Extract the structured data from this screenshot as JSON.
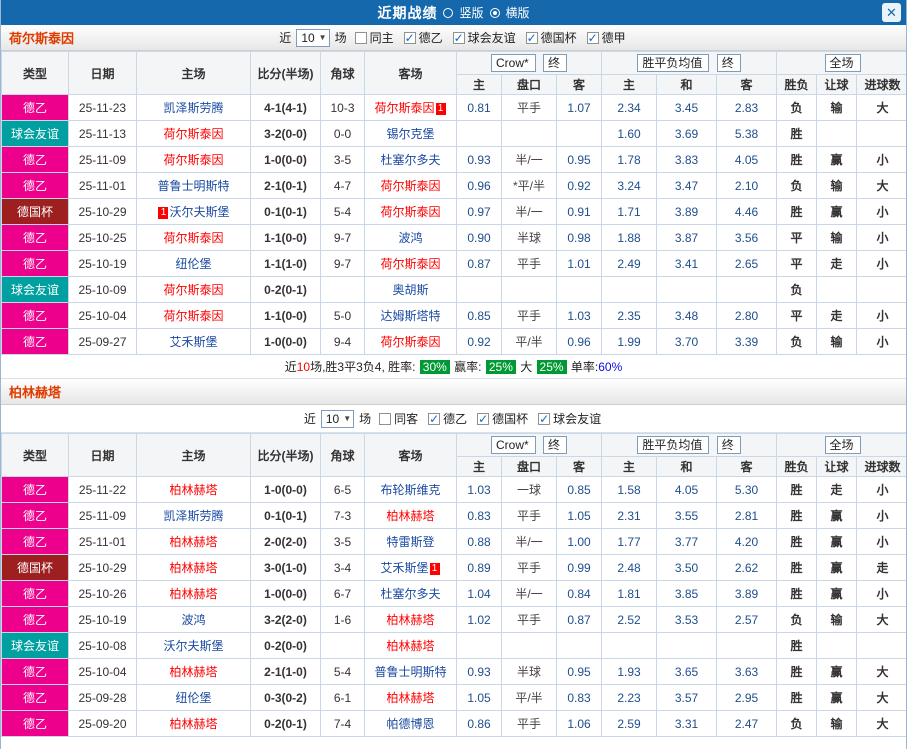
{
  "titlebar": {
    "title": "近期战绩",
    "options": [
      {
        "label": "竖版",
        "checked": false
      },
      {
        "label": "横版",
        "checked": true
      }
    ]
  },
  "icons": {
    "chevron_down": "▼",
    "close": "✕"
  },
  "col_headers": {
    "type": "类型",
    "date": "日期",
    "home": "主场",
    "score": "比分(半场)",
    "corner": "角球",
    "away": "客场",
    "ah_home": "主",
    "ah_line": "盘口",
    "ah_away": "客",
    "eu_home": "主",
    "eu_draw": "和",
    "eu_away": "客",
    "wdl": "胜负",
    "handicap": "让球",
    "goals": "进球数"
  },
  "sections": [
    {
      "team": "荷尔斯泰因",
      "filter_inline": true,
      "filter": {
        "prefix": "近",
        "count": "10",
        "suffix": "场",
        "items": [
          {
            "label": "同主",
            "checked": false
          },
          {
            "label": "德乙",
            "checked": true
          },
          {
            "label": "球会友谊",
            "checked": true
          },
          {
            "label": "德国杯",
            "checked": true
          },
          {
            "label": "德甲",
            "checked": true
          }
        ]
      },
      "dropdowns": {
        "company": "Crow*",
        "stage1": "终",
        "eu_source": "胜平负均值",
        "stage2": "终",
        "scope": "全场"
      },
      "rows": [
        {
          "league": "德乙",
          "lc": "d2",
          "date": "25-11-23",
          "home": {
            "n": "凯泽斯劳腾"
          },
          "score": "4-1(4-1)",
          "sc": "red",
          "corner": "10-3",
          "away": {
            "n": "荷尔斯泰因",
            "hl": true,
            "badge": "1"
          },
          "ah": [
            "0.81",
            "平手",
            "1.07"
          ],
          "eu": [
            "2.34",
            "3.45",
            "2.83"
          ],
          "res": [
            [
              "负",
              "green"
            ],
            [
              "输",
              "green"
            ],
            [
              "大",
              "red"
            ]
          ]
        },
        {
          "league": "球会友谊",
          "lc": "fr",
          "date": "25-11-13",
          "home": {
            "n": "荷尔斯泰因",
            "hl": true
          },
          "score": "3-2(0-0)",
          "sc": "red",
          "corner": "0-0",
          "away": {
            "n": "锡尔克堡"
          },
          "ah": [
            "",
            "",
            ""
          ],
          "eu": [
            "1.60",
            "3.69",
            "5.38"
          ],
          "res": [
            [
              "胜",
              "red"
            ],
            [
              "",
              ""
            ],
            [
              "",
              ""
            ]
          ]
        },
        {
          "league": "德乙",
          "lc": "d2",
          "date": "25-11-09",
          "home": {
            "n": "荷尔斯泰因",
            "hl": true
          },
          "score": "1-0(0-0)",
          "sc": "red",
          "corner": "3-5",
          "away": {
            "n": "杜塞尔多夫"
          },
          "ah": [
            "0.93",
            "半/一",
            "0.95"
          ],
          "eu": [
            "1.78",
            "3.83",
            "4.05"
          ],
          "res": [
            [
              "胜",
              "red"
            ],
            [
              "赢",
              "red"
            ],
            [
              "小",
              "green"
            ]
          ]
        },
        {
          "league": "德乙",
          "lc": "d2",
          "date": "25-11-01",
          "home": {
            "n": "普鲁士明斯特"
          },
          "score": "2-1(0-1)",
          "sc": "red",
          "corner": "4-7",
          "away": {
            "n": "荷尔斯泰因",
            "hl": true
          },
          "ah": [
            "0.96",
            "*平/半",
            "0.92"
          ],
          "eu": [
            "3.24",
            "3.47",
            "2.10"
          ],
          "res": [
            [
              "负",
              "green"
            ],
            [
              "输",
              "green"
            ],
            [
              "大",
              "red"
            ]
          ]
        },
        {
          "league": "德国杯",
          "lc": "cup",
          "date": "25-10-29",
          "home": {
            "n": "沃尔夫斯堡",
            "badge": "1",
            "badge_before": true
          },
          "score": "0-1(0-1)",
          "sc": "green",
          "corner": "5-4",
          "away": {
            "n": "荷尔斯泰因",
            "hl": true
          },
          "ah": [
            "0.97",
            "半/一",
            "0.91"
          ],
          "eu": [
            "1.71",
            "3.89",
            "4.46"
          ],
          "res": [
            [
              "胜",
              "red"
            ],
            [
              "赢",
              "red"
            ],
            [
              "小",
              "green"
            ]
          ]
        },
        {
          "league": "德乙",
          "lc": "d2",
          "date": "25-10-25",
          "home": {
            "n": "荷尔斯泰因",
            "hl": true
          },
          "score": "1-1(0-0)",
          "sc": "blue",
          "corner": "9-7",
          "away": {
            "n": "波鸿"
          },
          "ah": [
            "0.90",
            "半球",
            "0.98"
          ],
          "eu": [
            "1.88",
            "3.87",
            "3.56"
          ],
          "res": [
            [
              "平",
              "blue"
            ],
            [
              "输",
              "green"
            ],
            [
              "小",
              "green"
            ]
          ]
        },
        {
          "league": "德乙",
          "lc": "d2",
          "date": "25-10-19",
          "home": {
            "n": "纽伦堡"
          },
          "score": "1-1(1-0)",
          "sc": "blue",
          "corner": "9-7",
          "away": {
            "n": "荷尔斯泰因",
            "hl": true
          },
          "ah": [
            "0.87",
            "平手",
            "1.01"
          ],
          "eu": [
            "2.49",
            "3.41",
            "2.65"
          ],
          "res": [
            [
              "平",
              "blue"
            ],
            [
              "走",
              "blue"
            ],
            [
              "小",
              "green"
            ]
          ]
        },
        {
          "league": "球会友谊",
          "lc": "fr",
          "date": "25-10-09",
          "home": {
            "n": "荷尔斯泰因",
            "hl": true
          },
          "score": "0-2(0-1)",
          "sc": "green",
          "corner": "",
          "away": {
            "n": "奥胡斯"
          },
          "ah": [
            "",
            "",
            ""
          ],
          "eu": [
            "",
            "",
            ""
          ],
          "res": [
            [
              "负",
              "green"
            ],
            [
              "",
              ""
            ],
            [
              "",
              ""
            ]
          ]
        },
        {
          "league": "德乙",
          "lc": "d2",
          "date": "25-10-04",
          "home": {
            "n": "荷尔斯泰因",
            "hl": true
          },
          "score": "1-1(0-0)",
          "sc": "blue",
          "corner": "5-0",
          "away": {
            "n": "达姆斯塔特"
          },
          "ah": [
            "0.85",
            "平手",
            "1.03"
          ],
          "eu": [
            "2.35",
            "3.48",
            "2.80"
          ],
          "res": [
            [
              "平",
              "blue"
            ],
            [
              "走",
              "blue"
            ],
            [
              "小",
              "green"
            ]
          ]
        },
        {
          "league": "德乙",
          "lc": "d2",
          "date": "25-09-27",
          "home": {
            "n": "艾禾斯堡"
          },
          "score": "1-0(0-0)",
          "sc": "red",
          "corner": "9-4",
          "away": {
            "n": "荷尔斯泰因",
            "hl": true
          },
          "ah": [
            "0.92",
            "平/半",
            "0.96"
          ],
          "eu": [
            "1.99",
            "3.70",
            "3.39"
          ],
          "res": [
            [
              "负",
              "green"
            ],
            [
              "输",
              "green"
            ],
            [
              "小",
              "green"
            ]
          ]
        }
      ],
      "summary": {
        "parts": [
          {
            "t": "近",
            "c": "plain"
          },
          {
            "t": "10",
            "c": "red"
          },
          {
            "t": "场,胜3平3负4, 胜率: ",
            "c": "plain"
          },
          {
            "t": "30%",
            "c": "badge"
          },
          {
            "t": " 赢率: ",
            "c": "plain"
          },
          {
            "t": "25%",
            "c": "badge"
          },
          {
            "t": " 大 ",
            "c": "plain"
          },
          {
            "t": "25%",
            "c": "badge"
          },
          {
            "t": " 单率:",
            "c": "plain"
          },
          {
            "t": "60%",
            "c": "blue"
          }
        ]
      }
    },
    {
      "team": "柏林赫塔",
      "filter_inline": false,
      "filter": {
        "prefix": "近",
        "count": "10",
        "suffix": "场",
        "items": [
          {
            "label": "同客",
            "checked": false
          },
          {
            "label": "德乙",
            "checked": true
          },
          {
            "label": "德国杯",
            "checked": true
          },
          {
            "label": "球会友谊",
            "checked": true
          }
        ]
      },
      "dropdowns": {
        "company": "Crow*",
        "stage1": "终",
        "eu_source": "胜平负均值",
        "stage2": "终",
        "scope": "全场"
      },
      "rows": [
        {
          "league": "德乙",
          "lc": "d2",
          "date": "25-11-22",
          "home": {
            "n": "柏林赫塔",
            "hl": true
          },
          "score": "1-0(0-0)",
          "sc": "red",
          "corner": "6-5",
          "away": {
            "n": "布轮斯维克"
          },
          "ah": [
            "1.03",
            "一球",
            "0.85"
          ],
          "eu": [
            "1.58",
            "4.05",
            "5.30"
          ],
          "res": [
            [
              "胜",
              "red"
            ],
            [
              "走",
              "blue"
            ],
            [
              "小",
              "green"
            ]
          ]
        },
        {
          "league": "德乙",
          "lc": "d2",
          "date": "25-11-09",
          "home": {
            "n": "凯泽斯劳腾"
          },
          "score": "0-1(0-1)",
          "sc": "green",
          "corner": "7-3",
          "away": {
            "n": "柏林赫塔",
            "hl": true
          },
          "ah": [
            "0.83",
            "平手",
            "1.05"
          ],
          "eu": [
            "2.31",
            "3.55",
            "2.81"
          ],
          "res": [
            [
              "胜",
              "red"
            ],
            [
              "赢",
              "red"
            ],
            [
              "小",
              "green"
            ]
          ]
        },
        {
          "league": "德乙",
          "lc": "d2",
          "date": "25-11-01",
          "home": {
            "n": "柏林赫塔",
            "hl": true
          },
          "score": "2-0(2-0)",
          "sc": "red",
          "corner": "3-5",
          "away": {
            "n": "特雷斯登"
          },
          "ah": [
            "0.88",
            "半/一",
            "1.00"
          ],
          "eu": [
            "1.77",
            "3.77",
            "4.20"
          ],
          "res": [
            [
              "胜",
              "red"
            ],
            [
              "赢",
              "red"
            ],
            [
              "小",
              "green"
            ]
          ]
        },
        {
          "league": "德国杯",
          "lc": "cup",
          "date": "25-10-29",
          "home": {
            "n": "柏林赫塔",
            "hl": true
          },
          "score": "3-0(1-0)",
          "sc": "red",
          "corner": "3-4",
          "away": {
            "n": "艾禾斯堡",
            "badge": "1"
          },
          "ah": [
            "0.89",
            "平手",
            "0.99"
          ],
          "eu": [
            "2.48",
            "3.50",
            "2.62"
          ],
          "res": [
            [
              "胜",
              "red"
            ],
            [
              "赢",
              "red"
            ],
            [
              "走",
              "blue"
            ]
          ]
        },
        {
          "league": "德乙",
          "lc": "d2",
          "date": "25-10-26",
          "home": {
            "n": "柏林赫塔",
            "hl": true
          },
          "score": "1-0(0-0)",
          "sc": "red",
          "corner": "6-7",
          "away": {
            "n": "杜塞尔多夫"
          },
          "ah": [
            "1.04",
            "半/一",
            "0.84"
          ],
          "eu": [
            "1.81",
            "3.85",
            "3.89"
          ],
          "res": [
            [
              "胜",
              "red"
            ],
            [
              "赢",
              "red"
            ],
            [
              "小",
              "green"
            ]
          ]
        },
        {
          "league": "德乙",
          "lc": "d2",
          "date": "25-10-19",
          "home": {
            "n": "波鸿"
          },
          "score": "3-2(2-0)",
          "sc": "red",
          "corner": "1-6",
          "away": {
            "n": "柏林赫塔",
            "hl": true
          },
          "ah": [
            "1.02",
            "平手",
            "0.87"
          ],
          "eu": [
            "2.52",
            "3.53",
            "2.57"
          ],
          "res": [
            [
              "负",
              "green"
            ],
            [
              "输",
              "green"
            ],
            [
              "大",
              "red"
            ]
          ]
        },
        {
          "league": "球会友谊",
          "lc": "fr",
          "date": "25-10-08",
          "home": {
            "n": "沃尔夫斯堡"
          },
          "score": "0-2(0-0)",
          "sc": "green",
          "corner": "",
          "away": {
            "n": "柏林赫塔",
            "hl": true
          },
          "ah": [
            "",
            "",
            ""
          ],
          "eu": [
            "",
            "",
            ""
          ],
          "res": [
            [
              "胜",
              "red"
            ],
            [
              "",
              ""
            ],
            [
              "",
              ""
            ]
          ]
        },
        {
          "league": "德乙",
          "lc": "d2",
          "date": "25-10-04",
          "home": {
            "n": "柏林赫塔",
            "hl": true
          },
          "score": "2-1(1-0)",
          "sc": "red",
          "corner": "5-4",
          "away": {
            "n": "普鲁士明斯特"
          },
          "ah": [
            "0.93",
            "半球",
            "0.95"
          ],
          "eu": [
            "1.93",
            "3.65",
            "3.63"
          ],
          "res": [
            [
              "胜",
              "red"
            ],
            [
              "赢",
              "red"
            ],
            [
              "大",
              "red"
            ]
          ]
        },
        {
          "league": "德乙",
          "lc": "d2",
          "date": "25-09-28",
          "home": {
            "n": "纽伦堡"
          },
          "score": "0-3(0-2)",
          "sc": "green",
          "corner": "6-1",
          "away": {
            "n": "柏林赫塔",
            "hl": true
          },
          "ah": [
            "1.05",
            "平/半",
            "0.83"
          ],
          "eu": [
            "2.23",
            "3.57",
            "2.95"
          ],
          "res": [
            [
              "胜",
              "red"
            ],
            [
              "赢",
              "red"
            ],
            [
              "大",
              "red"
            ]
          ]
        },
        {
          "league": "德乙",
          "lc": "d2",
          "date": "25-09-20",
          "home": {
            "n": "柏林赫塔",
            "hl": true
          },
          "score": "0-2(0-1)",
          "sc": "green",
          "corner": "7-4",
          "away": {
            "n": "帕德博恩"
          },
          "ah": [
            "0.86",
            "平手",
            "1.06"
          ],
          "eu": [
            "2.59",
            "3.31",
            "2.47"
          ],
          "res": [
            [
              "负",
              "green"
            ],
            [
              "输",
              "green"
            ],
            [
              "大",
              "red"
            ]
          ]
        }
      ],
      "summary": null
    }
  ]
}
